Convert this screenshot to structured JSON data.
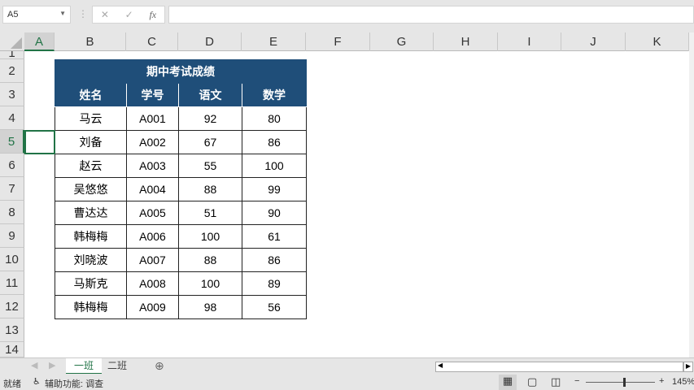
{
  "formula_bar": {
    "name_box": "A5",
    "cancel": "✕",
    "enter": "✓",
    "fx": "fx",
    "formula": ""
  },
  "columns": [
    "A",
    "B",
    "C",
    "D",
    "E",
    "F",
    "G",
    "H",
    "I",
    "J",
    "K"
  ],
  "rows": [
    "1",
    "2",
    "3",
    "4",
    "5",
    "6",
    "7",
    "8",
    "9",
    "10",
    "11",
    "12",
    "13",
    "14"
  ],
  "table": {
    "title": "期中考试成绩",
    "headers": [
      "姓名",
      "学号",
      "语文",
      "数学"
    ],
    "rows": [
      [
        "马云",
        "A001",
        "92",
        "80"
      ],
      [
        "刘备",
        "A002",
        "67",
        "86"
      ],
      [
        "赵云",
        "A003",
        "55",
        "100"
      ],
      [
        "吴悠悠",
        "A004",
        "88",
        "99"
      ],
      [
        "曹达达",
        "A005",
        "51",
        "90"
      ],
      [
        "韩梅梅",
        "A006",
        "100",
        "61"
      ],
      [
        "刘晓波",
        "A007",
        "88",
        "86"
      ],
      [
        "马斯克",
        "A008",
        "100",
        "89"
      ],
      [
        "韩梅梅",
        "A009",
        "98",
        "56"
      ]
    ]
  },
  "sheets": [
    "一班",
    "二班"
  ],
  "status": {
    "ready": "就绪",
    "accessibility": "辅助功能: 调查",
    "zoom": "145%"
  },
  "colors": {
    "header_bg": "#1f4e79",
    "accent": "#217346"
  }
}
